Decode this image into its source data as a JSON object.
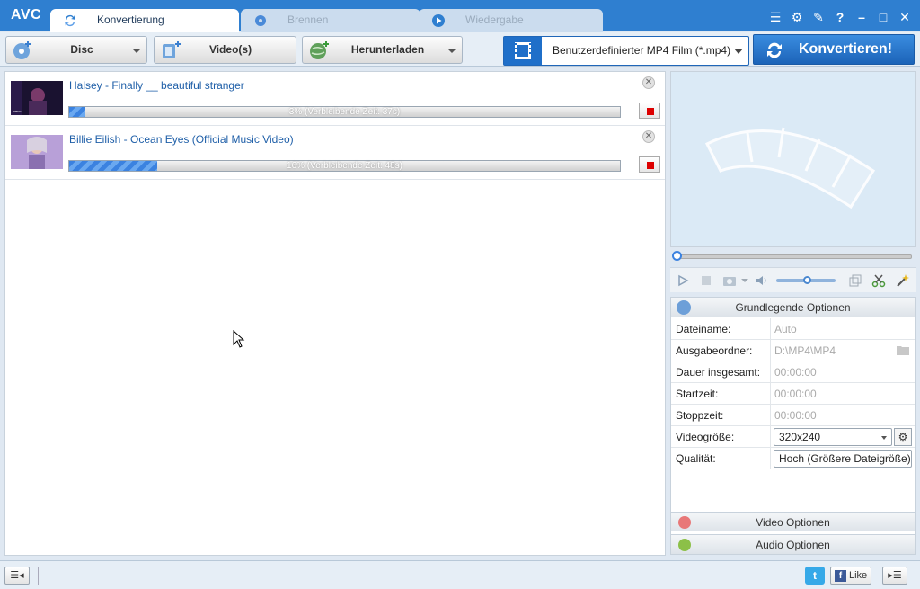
{
  "app": {
    "logo": "AVC"
  },
  "tabs": [
    {
      "label": "Konvertierung",
      "active": true
    },
    {
      "label": "Brennen",
      "active": false
    },
    {
      "label": "Wiedergabe",
      "active": false
    }
  ],
  "window_controls": {
    "help": "?"
  },
  "toolbar": {
    "disc_label": "Disc",
    "videos_label": "Video(s)",
    "download_label": "Herunterladen",
    "profile_label": "Benutzerdefinierter MP4 Film (*.mp4)",
    "convert_label": "Konvertieren!"
  },
  "items": [
    {
      "title": "Halsey - Finally __ beautiful stranger",
      "progress": 0.03,
      "progress_text": "3% (Verbleibende Zeit: 37s)"
    },
    {
      "title": "Billie Eilish - Ocean Eyes (Official Music Video)",
      "progress": 0.16,
      "progress_text": "16% (Verbleibende Zeit: 48s)"
    }
  ],
  "options": {
    "header": "Grundlegende Optionen",
    "rows": [
      {
        "label": "Dateiname:",
        "value": "Auto"
      },
      {
        "label": "Ausgabeordner:",
        "value": "D:\\MP4\\MP4"
      },
      {
        "label": "Dauer insgesamt:",
        "value": "00:00:00"
      },
      {
        "label": "Startzeit:",
        "value": "00:00:00"
      },
      {
        "label": "Stoppzeit:",
        "value": "00:00:00"
      },
      {
        "label": "Videogröße:",
        "value": "320x240"
      },
      {
        "label": "Qualität:",
        "value": "Hoch (Größere Dateigröße)"
      }
    ],
    "video_options": "Video Optionen",
    "audio_options": "Audio Optionen"
  },
  "bottom": {
    "like_label": "Like",
    "facebook_letter": "f",
    "twitter_letter": "t"
  },
  "colors": {
    "titlebar": "#2f7fd0",
    "accent": "#1f6fc9",
    "progress": "#3b82e0",
    "stop": "#dd0000"
  }
}
